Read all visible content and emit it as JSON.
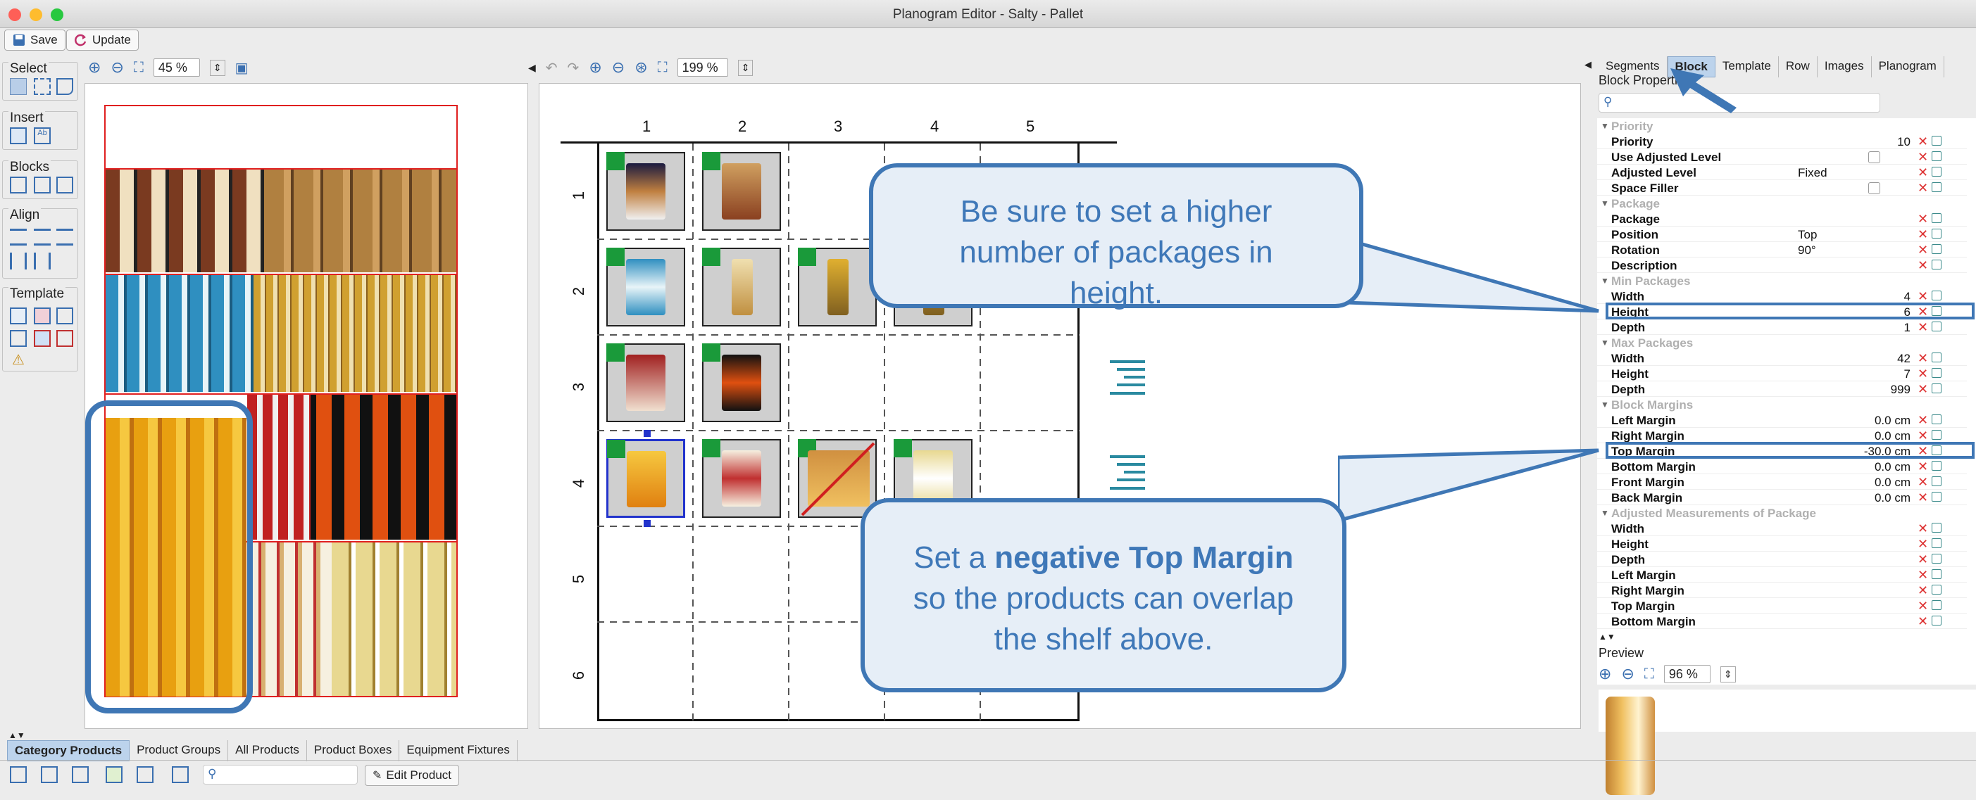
{
  "window": {
    "title": "Planogram Editor - Salty - Pallet"
  },
  "toolbar": {
    "save_label": "Save",
    "update_label": "Update"
  },
  "left_tools": {
    "select": "Select",
    "insert": "Insert",
    "blocks": "Blocks",
    "align": "Align",
    "template": "Template"
  },
  "left_panel": {
    "zoom": "45 %"
  },
  "center_panel": {
    "zoom": "199 %",
    "columns": [
      "1",
      "2",
      "3",
      "4",
      "5"
    ],
    "rows": [
      "1",
      "2",
      "3",
      "4",
      "5",
      "6"
    ]
  },
  "right_panel": {
    "tabs": [
      "Segments",
      "Block",
      "Template",
      "Row",
      "Images",
      "Planogram"
    ],
    "selected_tab": "Block",
    "section_title": "Block Properties",
    "search_placeholder": "",
    "properties": {
      "priority_section": "Priority",
      "priority": {
        "label": "Priority",
        "value": "10"
      },
      "use_adjusted_level": {
        "label": "Use Adjusted Level",
        "checked": false
      },
      "adjusted_level": {
        "label": "Adjusted Level",
        "value": "Fixed"
      },
      "space_filler": {
        "label": "Space Filler",
        "checked": false
      },
      "package_section": "Package",
      "package": {
        "label": "Package",
        "value": ""
      },
      "position": {
        "label": "Position",
        "value": "Top"
      },
      "rotation": {
        "label": "Rotation",
        "value": "90°"
      },
      "description": {
        "label": "Description",
        "value": ""
      },
      "min_packages_section": "Min Packages",
      "min_width": {
        "label": "Width",
        "value": "4"
      },
      "min_height": {
        "label": "Height",
        "value": "6"
      },
      "min_depth": {
        "label": "Depth",
        "value": "1"
      },
      "max_packages_section": "Max Packages",
      "max_width": {
        "label": "Width",
        "value": "42"
      },
      "max_height": {
        "label": "Height",
        "value": "7"
      },
      "max_depth": {
        "label": "Depth",
        "value": "999"
      },
      "block_margins_section": "Block Margins",
      "left_margin": {
        "label": "Left Margin",
        "value": "0.0 cm"
      },
      "right_margin": {
        "label": "Right Margin",
        "value": "0.0 cm"
      },
      "top_margin": {
        "label": "Top Margin",
        "value": "-30.0 cm"
      },
      "bottom_margin": {
        "label": "Bottom Margin",
        "value": "0.0 cm"
      },
      "front_margin": {
        "label": "Front Margin",
        "value": "0.0 cm"
      },
      "back_margin": {
        "label": "Back Margin",
        "value": "0.0 cm"
      },
      "adjusted_section": "Adjusted Measurements of Package",
      "adj_width": {
        "label": "Width"
      },
      "adj_height": {
        "label": "Height"
      },
      "adj_depth": {
        "label": "Depth"
      },
      "adj_left": {
        "label": "Left Margin"
      },
      "adj_right": {
        "label": "Right Margin"
      },
      "adj_top": {
        "label": "Top Margin"
      },
      "adj_bottom": {
        "label": "Bottom Margin"
      }
    },
    "preview_label": "Preview",
    "preview_zoom": "96 %"
  },
  "bottom": {
    "tabs": [
      "Category Products",
      "Product Groups",
      "All Products",
      "Product Boxes",
      "Equipment Fixtures"
    ],
    "selected_tab": "Category Products",
    "edit_product_label": "Edit Product"
  },
  "callouts": {
    "top_text": "Be sure to set a higher number of packages in height.",
    "bottom_prefix": "Set a ",
    "bottom_bold": "negative Top Margin",
    "bottom_suffix": " so the products can overlap the shelf above."
  },
  "colors": {
    "accent": "#3f77b5",
    "grid_marker": "#1a9a3a",
    "error_x": "#d33333",
    "selection": "#2233cc"
  }
}
